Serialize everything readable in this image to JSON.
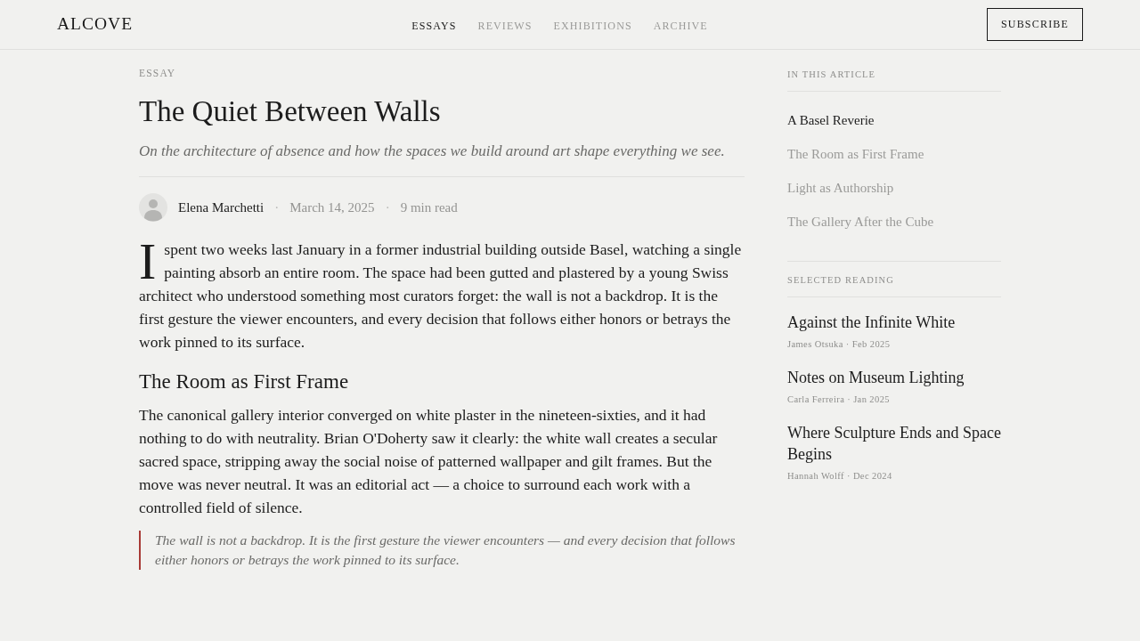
{
  "header": {
    "logo": "ALCOVE",
    "nav": [
      {
        "label": "ESSAYS",
        "selected": true
      },
      {
        "label": "REVIEWS",
        "selected": false
      },
      {
        "label": "EXHIBITIONS",
        "selected": false
      },
      {
        "label": "ARCHIVE",
        "selected": false
      }
    ],
    "subscribe_button": "SUBSCRIBE"
  },
  "article": {
    "kicker": "ESSAY",
    "title": "The Quiet Between Walls",
    "subtitle": "On the architecture of absence and how the spaces we build around art shape everything we see.",
    "byline": [
      {
        "kind": "author",
        "text": "Elena Marchetti"
      },
      {
        "kind": "separator",
        "text": "·"
      },
      {
        "kind": "meta",
        "text": "March 14, 2025"
      },
      {
        "kind": "separator",
        "text": "·"
      },
      {
        "kind": "meta",
        "text": "9 min read"
      }
    ],
    "body": [
      {
        "kind": "paragraph",
        "drop_cap": true,
        "text": "I spent two weeks last January in a former industrial building outside Basel, watching a single painting absorb an entire room. The space had been gutted and plastered by a young Swiss architect who understood something most curators forget: the wall is not a backdrop. It is the first gesture the viewer encounters, and every decision that follows either honors or betrays the work pinned to its surface."
      },
      {
        "kind": "heading",
        "text": "The Room as First Frame"
      },
      {
        "kind": "paragraph",
        "drop_cap": false,
        "text": "The canonical gallery interior converged on white plaster in the nineteen-sixties, and it had nothing to do with neutrality. Brian O'Doherty saw it clearly: the white wall creates a secular sacred space, stripping away the social noise of patterned wallpaper and gilt frames. But the move was never neutral. It was an editorial act — a choice to surround each work with a controlled field of silence."
      },
      {
        "kind": "quote",
        "text": "The wall is not a backdrop. It is the first gesture the viewer encounters — and every decision that follows either honors or betrays the work pinned to its surface."
      }
    ]
  },
  "sidebar": {
    "toc": {
      "title": "IN THIS ARTICLE",
      "items": [
        {
          "label": "A Basel Reverie",
          "selected": true
        },
        {
          "label": "The Room as First Frame",
          "selected": false
        },
        {
          "label": "Light as Authorship",
          "selected": false
        },
        {
          "label": "The Gallery After the Cube",
          "selected": false
        }
      ]
    },
    "reading": {
      "title": "SELECTED READING",
      "items": [
        {
          "title": "Against the Infinite White",
          "meta": "James Otsuka · Feb 2025"
        },
        {
          "title": "Notes on Museum Lighting",
          "meta": "Carla Ferreira · Jan 2025"
        },
        {
          "title": "Where Sculpture Ends and Space Begins",
          "meta": "Hannah Wolff · Dec 2024"
        }
      ]
    }
  }
}
